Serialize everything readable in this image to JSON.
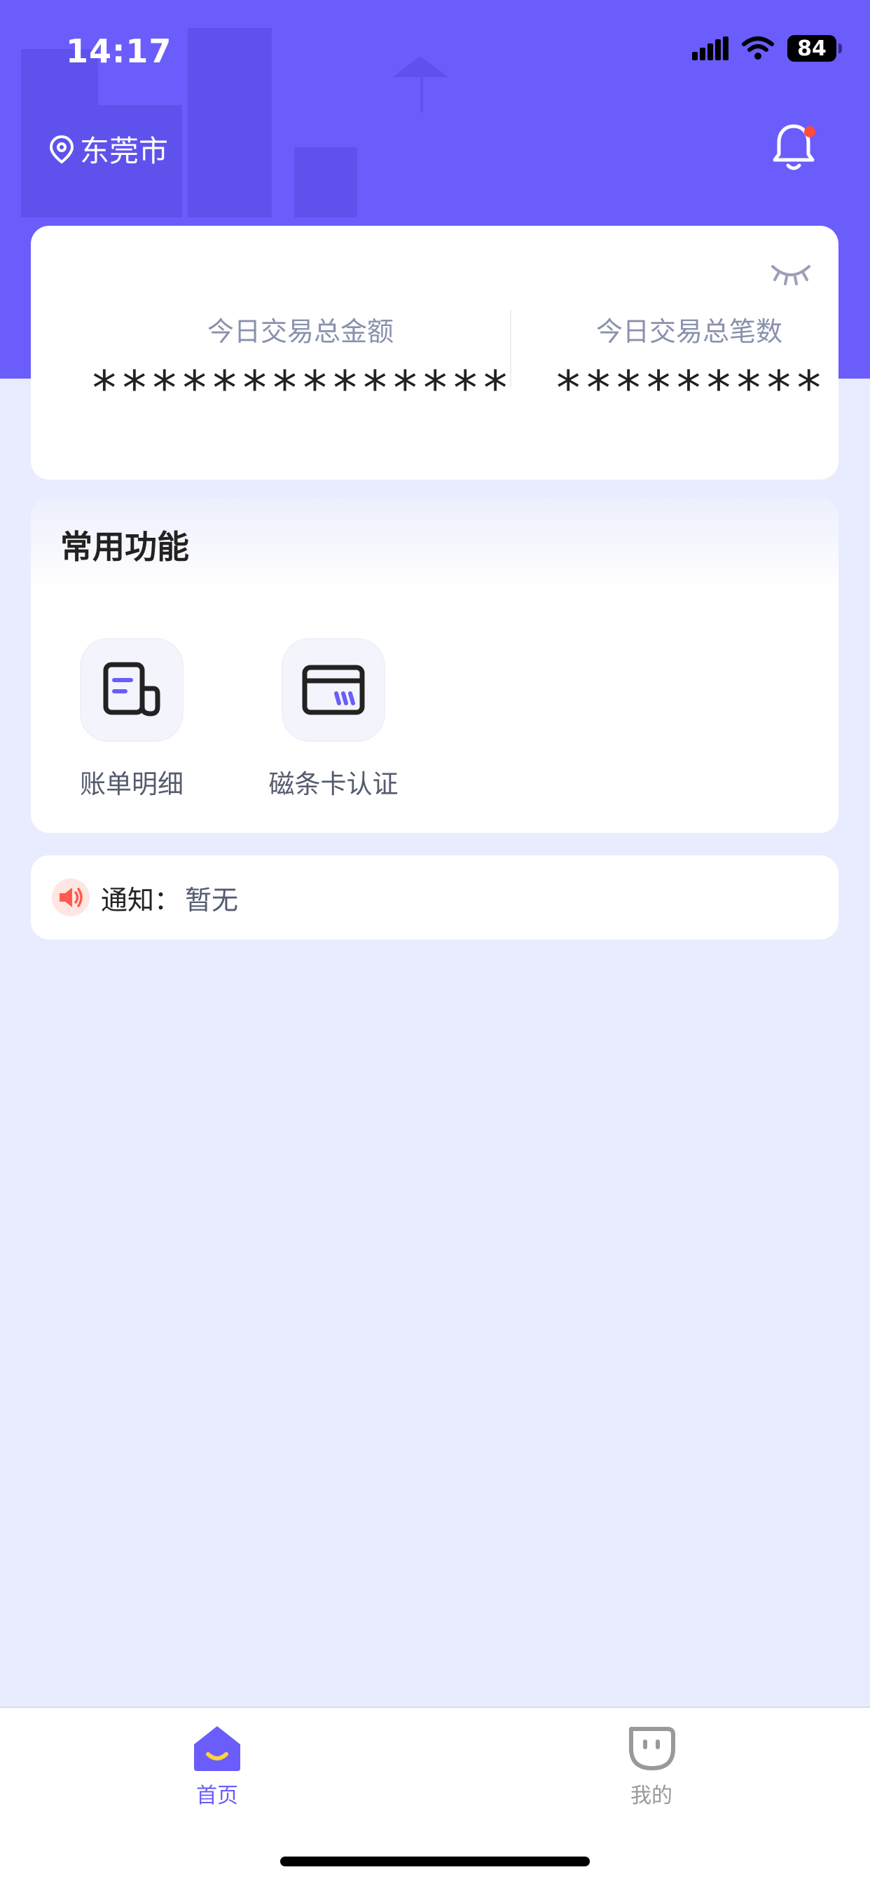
{
  "status_bar": {
    "time": "14:17",
    "battery": "84"
  },
  "header": {
    "location": "东莞市",
    "location_icon": "location-pin-icon",
    "bell_icon": "bell-icon",
    "has_unread": true
  },
  "summary": {
    "amount_label": "今日交易总金额",
    "amount_value": "**************",
    "count_label": "今日交易总笔数",
    "count_value": "*********",
    "toggle_icon": "eye-closed-icon"
  },
  "functions": {
    "title": "常用功能",
    "items": [
      {
        "label": "账单明细",
        "icon": "bill-detail-icon"
      },
      {
        "label": "磁条卡认证",
        "icon": "card-verify-icon"
      }
    ]
  },
  "notice": {
    "label": "通知：",
    "value": "暂无",
    "icon": "speaker-icon"
  },
  "tabbar": {
    "items": [
      {
        "label": "首页",
        "icon": "home-icon",
        "active": true
      },
      {
        "label": "我的",
        "icon": "profile-icon",
        "active": false
      }
    ]
  },
  "colors": {
    "primary": "#6a5dfb",
    "page_background": "#e9ecff",
    "notice_red": "#ff5c4d",
    "yellow_accent": "#ffd23f"
  }
}
